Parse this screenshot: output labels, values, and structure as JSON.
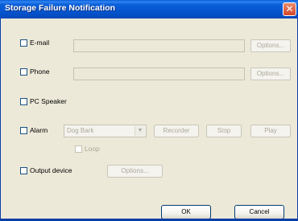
{
  "window": {
    "title": "Storage Failure Notification",
    "close_glyph": "✕"
  },
  "email": {
    "label": "E-mail",
    "checked": false,
    "value": "",
    "options_label": "Options..."
  },
  "phone": {
    "label": "Phone",
    "checked": false,
    "value": "",
    "options_label": "Options..."
  },
  "pc_speaker": {
    "label": "PC Speaker",
    "checked": false
  },
  "alarm": {
    "label": "Alarm",
    "checked": false,
    "sound_selected": "Dog Bark",
    "recorder_label": "Recorder",
    "stop_label": "Stop",
    "play_label": "Play",
    "loop_label": "Loop",
    "loop_checked": false,
    "dropdown_icon": "chevron-down-icon"
  },
  "output_device": {
    "label": "Output device",
    "checked": false,
    "options_label": "Options..."
  },
  "footer": {
    "ok_label": "OK",
    "cancel_label": "Cancel"
  },
  "colors": {
    "titlebar": "#0a5fd8",
    "dialog_bg": "#ece9d8",
    "close_button": "#d5472b",
    "disabled_text": "#aca899"
  }
}
